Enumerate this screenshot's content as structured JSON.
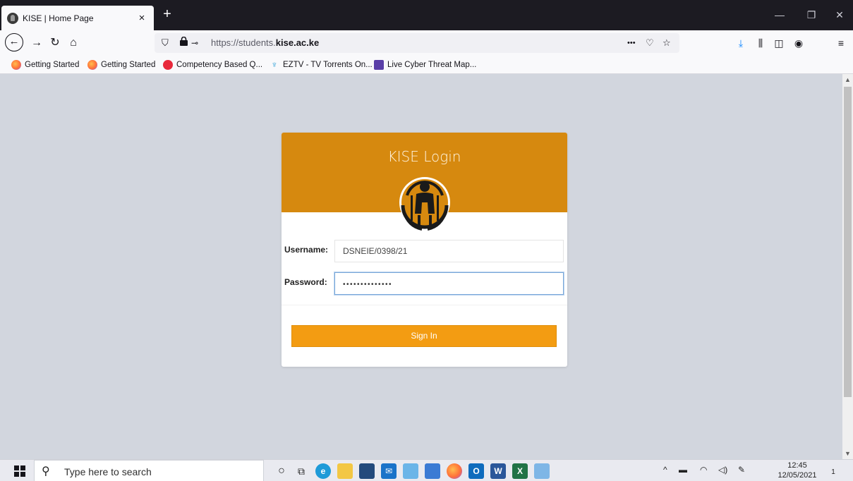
{
  "browser": {
    "tab_title": "KISE | Home Page",
    "tab_close": "×",
    "new_tab": "+",
    "url_prefix": "https://students.",
    "url_domain": "kise.ac.ke",
    "page_actions": "•••",
    "window_controls": {
      "minimize": "—",
      "restore": "❐",
      "close": "✕"
    }
  },
  "bookmarks": [
    {
      "label": "Getting Started",
      "icon": "firefox-icon"
    },
    {
      "label": "Getting Started",
      "icon": "firefox-icon"
    },
    {
      "label": "Competency Based Q...",
      "icon": "opera-icon"
    },
    {
      "label": "EZTV - TV Torrents On...",
      "icon": "eztv-icon"
    },
    {
      "label": "Live Cyber Threat Map...",
      "icon": "threat-map-icon"
    }
  ],
  "login": {
    "title": "KISE Login",
    "username_label": "Username:",
    "username_value": "DSNEIE/0398/21",
    "password_label": "Password:",
    "password_value": "••••••••••••••",
    "signin_label": "Sign In",
    "header_color": "#d6890f",
    "button_color": "#f39c12"
  },
  "taskbar": {
    "search_placeholder": "Type here to search",
    "time": "12:45",
    "date": "12/05/2021",
    "notification_count": "1",
    "tray_chevron": "^"
  }
}
